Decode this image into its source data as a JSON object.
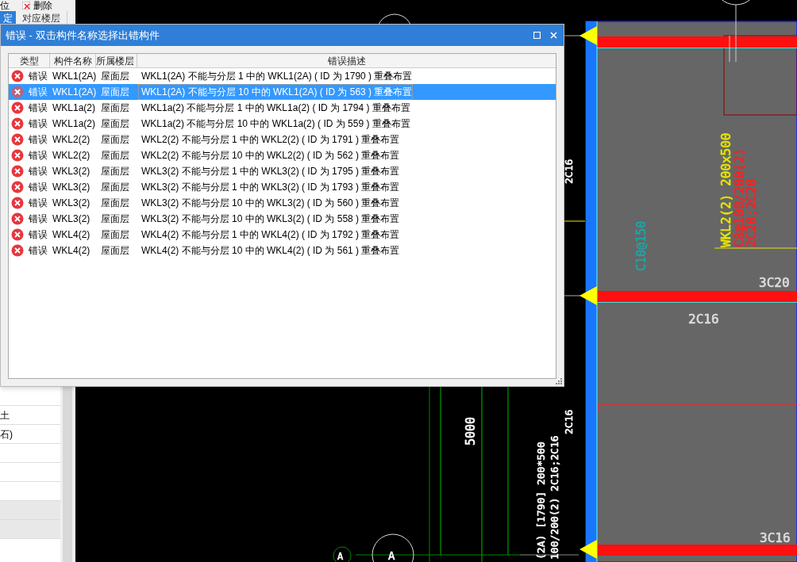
{
  "side_panel": {
    "toolbar": [
      {
        "label": "位",
        "kind": "text"
      },
      {
        "label": "删除",
        "kind": "delete"
      }
    ],
    "tabs": [
      {
        "label": "定",
        "selected": true
      },
      {
        "label": "对应楼层",
        "selected": false
      }
    ],
    "rows": [
      "",
      "土",
      "石)",
      "",
      "",
      "",
      "",
      ""
    ]
  },
  "dialog": {
    "title": "错误 - 双击构件名称选择出错构件",
    "columns": [
      "类型",
      "构件名称",
      "所属楼层",
      "错误描述"
    ],
    "rows": [
      {
        "type": "错误",
        "name": "WKL1(2A)",
        "floor": "屋面层",
        "description": "WKL1(2A) 不能与分层 1 中的 WKL1(2A) ( ID 为 1790 ) 重叠布置",
        "selected": false
      },
      {
        "type": "错误",
        "name": "WKL1(2A)",
        "floor": "屋面层",
        "description": "WKL1(2A) 不能与分层 10 中的 WKL1(2A) ( ID 为 563 ) 重叠布置",
        "selected": true
      },
      {
        "type": "错误",
        "name": "WKL1a(2)",
        "floor": "屋面层",
        "description": "WKL1a(2) 不能与分层 1 中的 WKL1a(2) ( ID 为 1794 ) 重叠布置",
        "selected": false
      },
      {
        "type": "错误",
        "name": "WKL1a(2)",
        "floor": "屋面层",
        "description": "WKL1a(2) 不能与分层 10 中的 WKL1a(2) ( ID 为 559 ) 重叠布置",
        "selected": false
      },
      {
        "type": "错误",
        "name": "WKL2(2)",
        "floor": "屋面层",
        "description": "WKL2(2) 不能与分层 1 中的 WKL2(2) ( ID 为 1791 ) 重叠布置",
        "selected": false
      },
      {
        "type": "错误",
        "name": "WKL2(2)",
        "floor": "屋面层",
        "description": "WKL2(2) 不能与分层 10 中的 WKL2(2) ( ID 为 562 ) 重叠布置",
        "selected": false
      },
      {
        "type": "错误",
        "name": "WKL3(2)",
        "floor": "屋面层",
        "description": "WKL3(2) 不能与分层 1 中的 WKL3(2) ( ID 为 1795 ) 重叠布置",
        "selected": false
      },
      {
        "type": "错误",
        "name": "WKL3(2)",
        "floor": "屋面层",
        "description": "WKL3(2) 不能与分层 1 中的 WKL3(2) ( ID 为 1793 ) 重叠布置",
        "selected": false
      },
      {
        "type": "错误",
        "name": "WKL3(2)",
        "floor": "屋面层",
        "description": "WKL3(2) 不能与分层 10 中的 WKL3(2) ( ID 为 560 ) 重叠布置",
        "selected": false
      },
      {
        "type": "错误",
        "name": "WKL3(2)",
        "floor": "屋面层",
        "description": "WKL3(2) 不能与分层 10 中的 WKL3(2) ( ID 为 558 ) 重叠布置",
        "selected": false
      },
      {
        "type": "错误",
        "name": "WKL4(2)",
        "floor": "屋面层",
        "description": "WKL4(2) 不能与分层 1 中的 WKL4(2) ( ID 为 1792 ) 重叠布置",
        "selected": false
      },
      {
        "type": "错误",
        "name": "WKL4(2)",
        "floor": "屋面层",
        "description": "WKL4(2) 不能与分层 10 中的 WKL4(2) ( ID 为 561 ) 重叠布置",
        "selected": false
      }
    ]
  },
  "cad_labels": [
    {
      "text": "2C16",
      "color": "#ffffff"
    },
    {
      "text": "WKL2(2) 200x500",
      "color": "#e6e600"
    },
    {
      "text": "C8@100/200(2)",
      "color": "#ff2020"
    },
    {
      "text": "2C20;2C20",
      "color": "#ff2020"
    },
    {
      "text": "C10@150",
      "color": "#1fa5a5"
    },
    {
      "text": "3C20",
      "color": "#dddddd"
    },
    {
      "text": "2C16",
      "color": "#dddddd"
    },
    {
      "text": "2C16",
      "color": "#ffffff"
    },
    {
      "text": "5000",
      "color": "#ffffff"
    },
    {
      "text": "(2A) [1790] 200*500",
      "color": "#ffffff"
    },
    {
      "text": "100/200(2) 2C16;2C16",
      "color": "#ffffff"
    },
    {
      "text": "3C16",
      "color": "#dddddd"
    },
    {
      "text": "A",
      "color": "#ffffff"
    },
    {
      "text": "A",
      "color": "#ffffff"
    }
  ]
}
